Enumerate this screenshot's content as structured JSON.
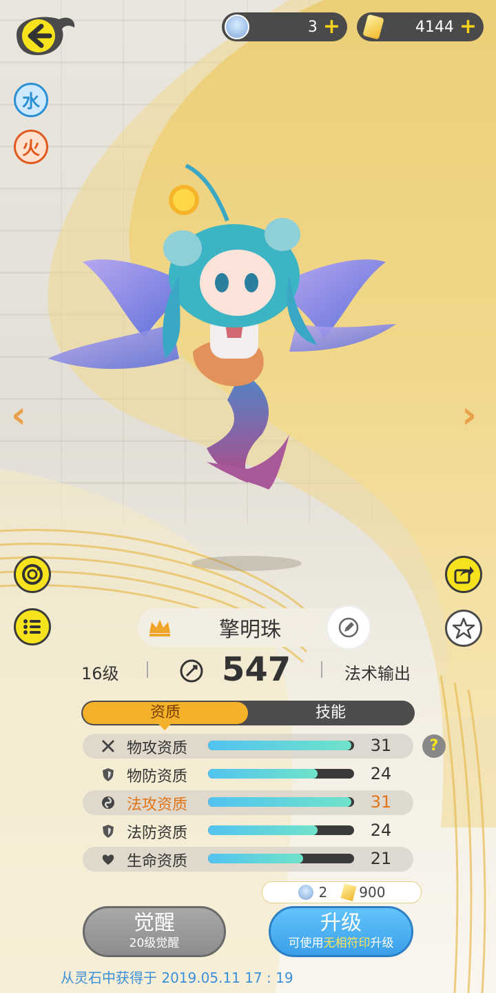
{
  "top_bar": {
    "gems": "3",
    "gold": "4144",
    "plus": "+"
  },
  "elements": [
    "水",
    "火"
  ],
  "pet": {
    "name": "擎明珠",
    "level": "16级",
    "power": "547",
    "role": "法术输出"
  },
  "tabs": [
    "资质",
    "技能"
  ],
  "stats": [
    {
      "label": "物攻资质",
      "value": "31",
      "fill": 0.98,
      "icon": "crossed-swords-icon",
      "highlight": false
    },
    {
      "label": "物防资质",
      "value": "24",
      "fill": 0.75,
      "icon": "shield-icon",
      "highlight": false
    },
    {
      "label": "法攻资质",
      "value": "31",
      "fill": 0.98,
      "icon": "magic-swirl-icon",
      "highlight": true
    },
    {
      "label": "法防资质",
      "value": "24",
      "fill": 0.75,
      "icon": "shield-icon",
      "highlight": false
    },
    {
      "label": "生命资质",
      "value": "21",
      "fill": 0.65,
      "icon": "heart-icon",
      "highlight": false
    }
  ],
  "help": "?",
  "cost": {
    "gems": "2",
    "gold": "900"
  },
  "buttons": {
    "awaken_label": "觉醒",
    "awaken_sub": "20级觉醒",
    "upgrade_label": "升级",
    "upgrade_sub_pre": "可使用",
    "upgrade_sub_hl": "无相符印",
    "upgrade_sub_post": "升级"
  },
  "footer": "从灵石中获得于 2019.05.11   17 : 19",
  "colors": {
    "accent": "#f4b22a",
    "bar": "#52c3f0",
    "highlight": "#e0751a",
    "link": "#3a8fd8"
  }
}
